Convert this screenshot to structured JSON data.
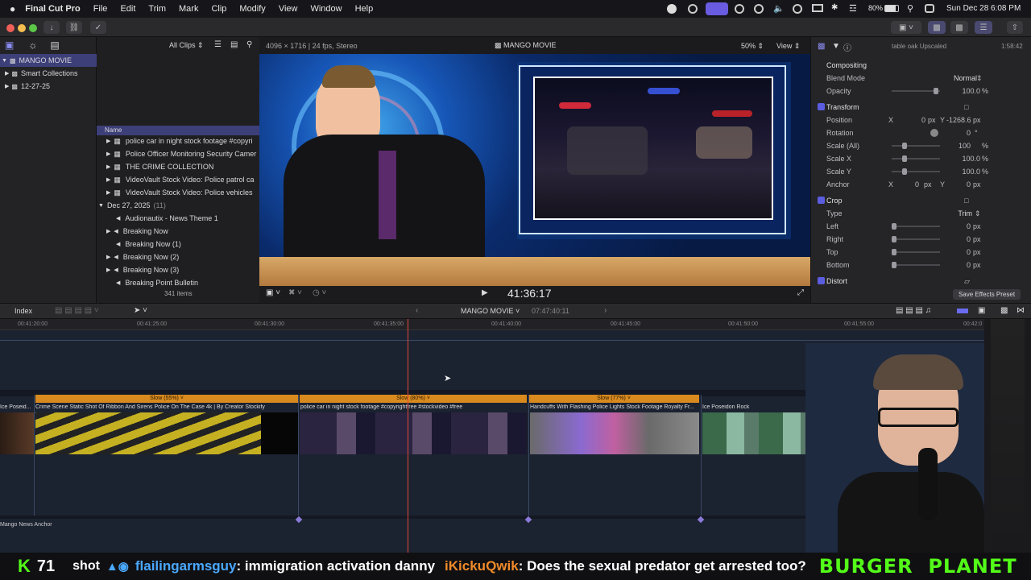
{
  "menubar": {
    "app": "Final Cut Pro",
    "items": [
      "File",
      "Edit",
      "Trim",
      "Mark",
      "Clip",
      "Modify",
      "View",
      "Window",
      "Help"
    ],
    "battery": "80%",
    "datetime": "Sun Dec 28  6:08 PM"
  },
  "library": {
    "title": "MANGO MOVIE",
    "items": [
      "Smart Collections",
      "12-27-25"
    ]
  },
  "browser": {
    "filter": "All Clips",
    "column": "Name",
    "rows": [
      "police  car in night stock footage #copyri",
      "Police Officer Monitoring Security Camer",
      "THE CRIME COLLECTION",
      "VideoVault Stock Video:  Police patrol ca",
      "VideoVault Stock Video:  Police vehicles"
    ],
    "date_group": "Dec 27, 2025",
    "date_count": "(11)",
    "rows2": [
      "Audionautix - News Theme 1",
      "Breaking Now",
      "Breaking Now (1)",
      "Breaking Now (2)",
      "Breaking Now (3)",
      "Breaking Point Bulletin"
    ],
    "count": "341 items"
  },
  "viewer": {
    "format": "4096 × 1716 | 24 fps, Stereo",
    "project": "MANGO MOVIE",
    "zoom": "50%",
    "view": "View",
    "timecode": "41:36:17"
  },
  "inspector": {
    "clip": "table oak Upscaled",
    "duration": "1:58:42",
    "compositing": "Compositing",
    "blend_label": "Blend Mode",
    "blend_value": "Normal",
    "opacity_label": "Opacity",
    "opacity_value": "100.0",
    "transform": "Transform",
    "position_label": "Position",
    "pos_x": "0",
    "pos_y": "-1268.6",
    "rotation_label": "Rotation",
    "rotation_value": "0",
    "scale_all_label": "Scale (All)",
    "scale_all": "100",
    "scale_x_label": "Scale X",
    "scale_x": "100.0",
    "scale_y_label": "Scale Y",
    "scale_y": "100.0",
    "anchor_label": "Anchor",
    "anchor_x": "0",
    "anchor_y": "0",
    "crop": "Crop",
    "type_label": "Type",
    "type_value": "Trim",
    "left_label": "Left",
    "right_label": "Right",
    "top_label": "Top",
    "bottom_label": "Bottom",
    "crop_val": "0",
    "distort": "Distort",
    "px": "px",
    "pct": "%",
    "deg": "°",
    "x": "X",
    "y": "Y",
    "save_preset": "Save Effects Preset"
  },
  "timeline": {
    "index": "Index",
    "project": "MANGO MOVIE",
    "duration": "07:47:40:11",
    "ticks": [
      "00:41:20:00",
      "00:41:25:00",
      "00:41:30:00",
      "00:41:35:00",
      "00:41:40:00",
      "00:41:45:00",
      "00:41:50:00",
      "00:41:55:00",
      "00:42:0"
    ],
    "speed": [
      "Slow (55%)",
      "Slow (80%)",
      "Slow (77%)"
    ],
    "clips": [
      "Ice Poseid...",
      "Crime Scene Static Shot Of Ribbon And Sirens Police On The Case 4k  | By Creator Stockify",
      "police  car in night stock footage #copyrightfree #stockvideo #free",
      "Handcuffs With Flashing Police Lights Stock Footage  Royalty Fr...",
      "Ice Poseidon Rock"
    ],
    "audio": "Mango News Anchor"
  },
  "ticker": {
    "k": "K",
    "num": "71",
    "t1": "shot",
    "user1": "flailingarmsguy",
    "msg1": " : immigration activation danny",
    "user2": "iKickuQwik",
    "msg2": " : Does the sexual predator get arrested too?",
    "brand": "BURGER  PLANET"
  },
  "colors": {
    "accent": "#5b5de0",
    "orange": "#d98a1e",
    "playhead": "#e0473a"
  }
}
